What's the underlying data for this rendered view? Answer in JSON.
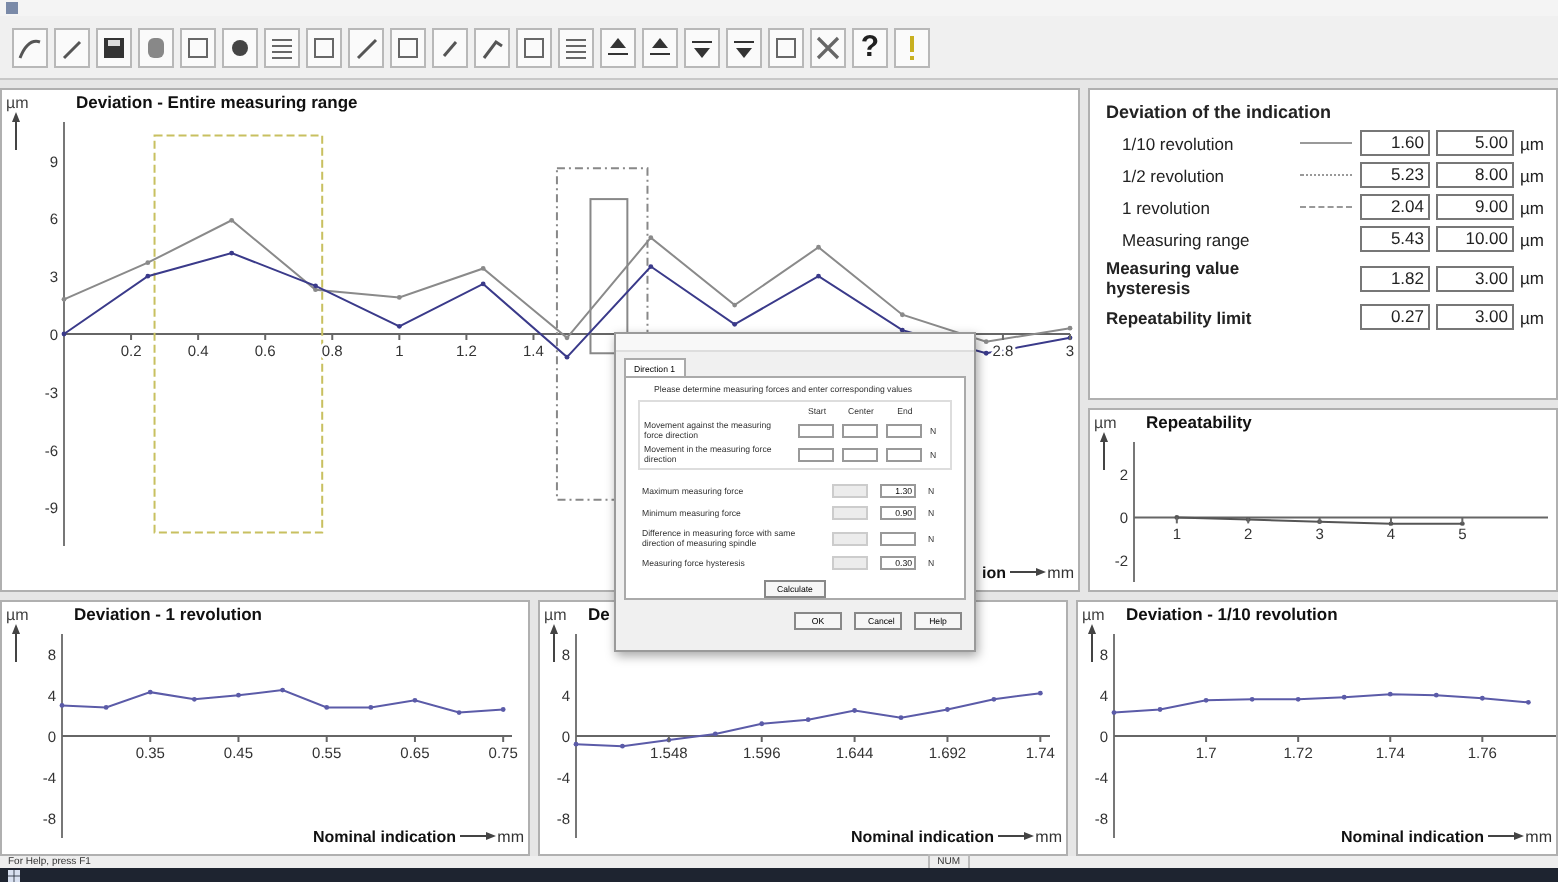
{
  "toolbar": {
    "help_button": "?"
  },
  "main_chart": {
    "x_unit": "mm",
    "chart_data": {
      "type": "line",
      "title": "Deviation - Entire measuring range",
      "ylabel": "µm",
      "xlabel": "ion",
      "x": [
        0,
        0.25,
        0.5,
        0.75,
        1,
        1.25,
        1.5,
        1.75,
        2,
        2.25,
        2.5,
        2.75,
        3
      ],
      "xlim": [
        0,
        3
      ],
      "ylim": [
        -11,
        11
      ],
      "xticks": [
        0.2,
        0.4,
        0.6,
        0.8,
        1,
        1.2,
        1.4,
        2.8,
        3
      ],
      "yticks": [
        -9,
        -6,
        -3,
        0,
        3,
        6,
        9
      ],
      "series": [
        {
          "color": "#8a8a8a",
          "values": [
            1.8,
            3.7,
            5.9,
            2.3,
            1.9,
            3.4,
            -0.2,
            5.0,
            1.5,
            4.5,
            1.0,
            -0.4,
            0.3
          ]
        },
        {
          "color": "#3a3a8a",
          "values": [
            0,
            3,
            4.2,
            2.5,
            0.4,
            2.6,
            -1.2,
            3.5,
            0.5,
            3.0,
            0.2,
            -1.0,
            -0.2
          ]
        }
      ]
    }
  },
  "deviation_table": {
    "title": "Deviation of the indication",
    "rows": [
      {
        "kind": "solid",
        "label": "1/10 revolution",
        "value": "1.60",
        "limit": "5.00",
        "unit": "µm"
      },
      {
        "kind": "dotted",
        "label": "1/2 revolution",
        "value": "5.23",
        "limit": "8.00",
        "unit": "µm"
      },
      {
        "kind": "dashed",
        "label": "1 revolution",
        "value": "2.04",
        "limit": "9.00",
        "unit": "µm"
      },
      {
        "kind": "sub",
        "label": "Measuring range",
        "value": "5.43",
        "limit": "10.00",
        "unit": "µm"
      },
      {
        "kind": "main",
        "label": "Measuring value hysteresis",
        "value": "1.82",
        "limit": "3.00",
        "unit": "µm"
      },
      {
        "kind": "main",
        "label": "Repeatability limit",
        "value": "0.27",
        "limit": "3.00",
        "unit": "µm"
      }
    ]
  },
  "repeatability_chart": {
    "chart_data": {
      "type": "line",
      "title": "Repeatability",
      "ylabel": "µm",
      "x": [
        1,
        2,
        3,
        4,
        5
      ],
      "xlim": [
        0.4,
        6.2
      ],
      "ylim": [
        -3,
        3.5
      ],
      "xticks": [
        1,
        2,
        3,
        4,
        5
      ],
      "yticks": [
        -2,
        0,
        2
      ],
      "series": [
        {
          "color": "#555555",
          "values": [
            0,
            -0.1,
            -0.2,
            -0.3,
            -0.3
          ]
        }
      ]
    }
  },
  "bottom_charts": [
    {
      "x_unit": "mm",
      "chart_data": {
        "type": "line",
        "title": "Deviation - 1 revolution",
        "ylabel": "µm",
        "xlabel": "Nominal indication",
        "x": [
          0.25,
          0.3,
          0.35,
          0.4,
          0.45,
          0.5,
          0.55,
          0.6,
          0.65,
          0.7,
          0.75
        ],
        "xlim": [
          0.25,
          0.76
        ],
        "ylim": [
          -10,
          10
        ],
        "xticks": [
          0.35,
          0.45,
          0.55,
          0.65,
          0.75
        ],
        "yticks": [
          -8,
          -4,
          0,
          4,
          8
        ],
        "series": [
          {
            "color": "#5b5ba8",
            "values": [
              3,
              2.8,
              4.3,
              3.6,
              4,
              4.5,
              2.8,
              2.8,
              3.5,
              2.3,
              2.6
            ]
          }
        ]
      }
    },
    {
      "x_unit": "mm",
      "chart_data": {
        "type": "line",
        "title": "De",
        "ylabel": "µm",
        "xlabel": "Nominal indication",
        "x": [
          1.5,
          1.524,
          1.548,
          1.572,
          1.596,
          1.62,
          1.644,
          1.668,
          1.692,
          1.716,
          1.74
        ],
        "xlim": [
          1.5,
          1.745
        ],
        "ylim": [
          -10,
          10
        ],
        "xticks": [
          1.548,
          1.596,
          1.644,
          1.692,
          1.74
        ],
        "yticks": [
          -8,
          -4,
          0,
          4,
          8
        ],
        "series": [
          {
            "color": "#5b5ba8",
            "values": [
              -0.8,
              -1,
              -0.4,
              0.2,
              1.2,
              1.6,
              2.5,
              1.8,
              2.6,
              3.6,
              4.2
            ]
          }
        ]
      }
    },
    {
      "x_unit": "mm",
      "chart_data": {
        "type": "line",
        "title": "Deviation - 1/10 revolution",
        "ylabel": "µm",
        "xlabel": "Nominal indication",
        "x": [
          1.68,
          1.69,
          1.7,
          1.71,
          1.72,
          1.73,
          1.74,
          1.75,
          1.76,
          1.77
        ],
        "xlim": [
          1.68,
          1.776
        ],
        "ylim": [
          -10,
          10
        ],
        "xticks": [
          1.7,
          1.72,
          1.74,
          1.76
        ],
        "yticks": [
          -8,
          -4,
          0,
          4,
          8
        ],
        "series": [
          {
            "color": "#5b5ba8",
            "values": [
              2.3,
              2.6,
              3.5,
              3.6,
              3.6,
              3.8,
              4.1,
              4,
              3.7,
              3.3
            ]
          }
        ]
      }
    }
  ],
  "dialog": {
    "tabs": [
      {
        "label": "Direction 1",
        "selected": true
      }
    ],
    "instruction": "Please determine measuring forces and enter corresponding values",
    "columns": [
      "Start",
      "Center",
      "End"
    ],
    "movement_rows": [
      {
        "label": "Movement against the measuring force direction",
        "unit": "N"
      },
      {
        "label": "Movement in the measuring force direction",
        "unit": "N"
      }
    ],
    "force_rows": [
      {
        "label": "Maximum measuring force",
        "value": "1.30",
        "unit": "N"
      },
      {
        "label": "Minimum measuring force",
        "value": "0.90",
        "unit": "N"
      },
      {
        "label": "Difference in measuring force with same direction of measuring spindle",
        "unit": "N"
      },
      {
        "label": "Measuring force hysteresis",
        "value": "0.30",
        "unit": "N"
      }
    ],
    "calculate_button": "Calculate",
    "buttons": [
      "OK",
      "Cancel",
      "Help"
    ]
  },
  "status_bar": {
    "text": "For Help, press F1",
    "indicator": "NUM"
  }
}
